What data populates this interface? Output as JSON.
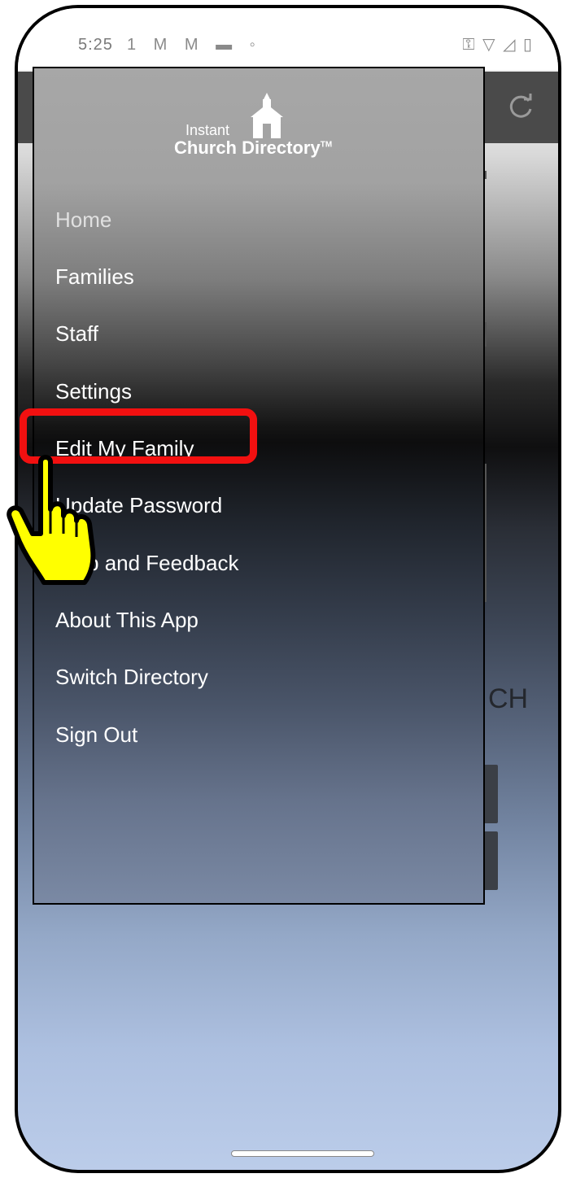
{
  "status_bar": {
    "time": "5:25",
    "left_icons": "1 M M ▬ ◦",
    "right_icons": "⚿ ▽ ◿ ▯"
  },
  "app": {
    "background_text": "CH"
  },
  "drawer": {
    "logo": {
      "line1": "Instant",
      "line2": "Church Directory",
      "tm": "TM"
    },
    "menu_items": [
      {
        "label": "Home"
      },
      {
        "label": "Families"
      },
      {
        "label": "Staff"
      },
      {
        "label": "Settings"
      },
      {
        "label": "Edit My Family"
      },
      {
        "label": "Update Password"
      },
      {
        "label": "Help and Feedback"
      },
      {
        "label": "About This App"
      },
      {
        "label": "Switch Directory"
      },
      {
        "label": "Sign Out"
      }
    ]
  },
  "annotation": {
    "highlight_color": "#f21010",
    "hand_color": "#ffff00"
  },
  "icons": {
    "refresh": "refresh-icon",
    "church": "church-icon",
    "pointer": "pointing-hand-icon"
  }
}
